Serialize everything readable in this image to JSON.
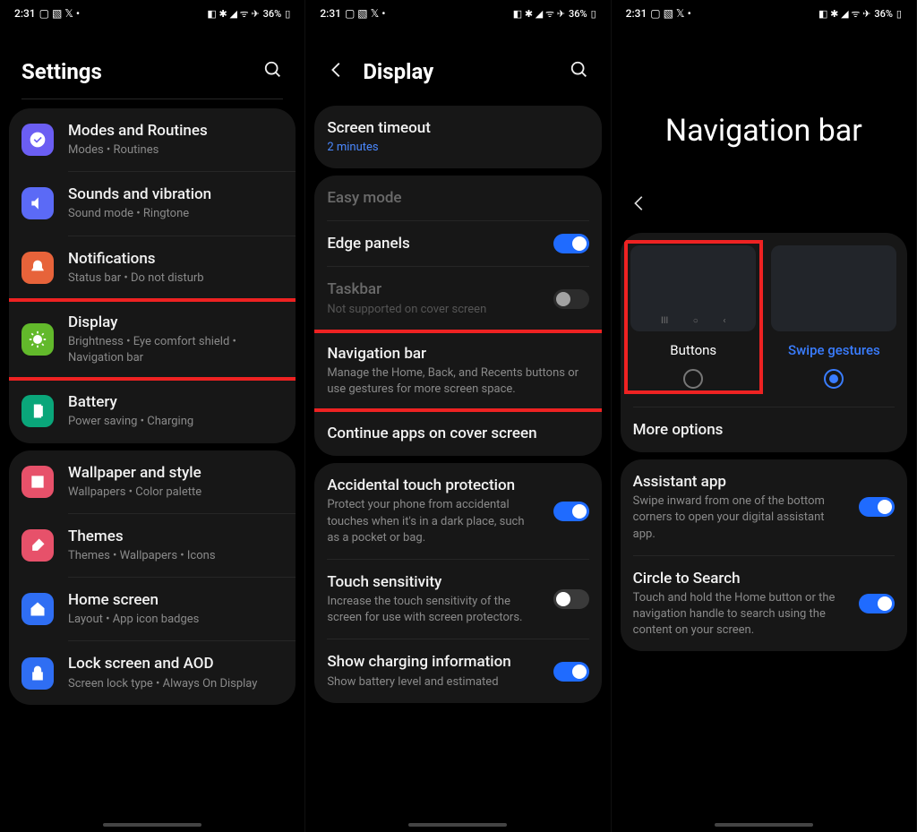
{
  "status": {
    "time": "2:31",
    "battery": "36%"
  },
  "s1": {
    "title": "Settings",
    "groups": [
      {
        "items": [
          {
            "key": "modes",
            "title": "Modes and Routines",
            "sub": "Modes  •  Routines",
            "color": "#6b5ef3",
            "icon": "check-circle"
          },
          {
            "key": "sounds",
            "title": "Sounds and vibration",
            "sub": "Sound mode  •  Ringtone",
            "color": "#5b6af6",
            "icon": "volume"
          },
          {
            "key": "notifications",
            "title": "Notifications",
            "sub": "Status bar  •  Do not disturb",
            "color": "#e7633a",
            "icon": "bell"
          },
          {
            "key": "display",
            "title": "Display",
            "sub": "Brightness  •  Eye comfort shield  •  Navigation bar",
            "color": "#62b92b",
            "icon": "sun",
            "highlight": true
          },
          {
            "key": "battery",
            "title": "Battery",
            "sub": "Power saving  •  Charging",
            "color": "#0aa67a",
            "icon": "battery"
          }
        ]
      },
      {
        "items": [
          {
            "key": "wallpaper",
            "title": "Wallpaper and style",
            "sub": "Wallpapers  •  Color palette",
            "color": "#e7516a",
            "icon": "image"
          },
          {
            "key": "themes",
            "title": "Themes",
            "sub": "Themes  •  Wallpapers  •  Icons",
            "color": "#e7516a",
            "icon": "brush"
          },
          {
            "key": "home",
            "title": "Home screen",
            "sub": "Layout  •  App icon badges",
            "color": "#2f6ef3",
            "icon": "home"
          },
          {
            "key": "lock",
            "title": "Lock screen and AOD",
            "sub": "Screen lock type  •  Always On Display",
            "color": "#2f6ef3",
            "icon": "lock"
          }
        ]
      }
    ]
  },
  "s2": {
    "title": "Display",
    "groups": [
      {
        "items": [
          {
            "key": "timeout",
            "title": "Screen timeout",
            "sub": "2 minutes",
            "subBlue": true
          }
        ]
      },
      {
        "items": [
          {
            "key": "easymode",
            "title": "Easy mode",
            "dim": true
          },
          {
            "key": "edge",
            "title": "Edge panels",
            "toggle": "on"
          },
          {
            "key": "taskbar",
            "title": "Taskbar",
            "sub": "Not supported on cover screen",
            "dim": true,
            "toggle": "off-dim"
          },
          {
            "key": "navbar",
            "title": "Navigation bar",
            "sub": "Manage the Home, Back, and Recents buttons or use gestures for more screen space.",
            "highlight": true
          },
          {
            "key": "continue",
            "title": "Continue apps on cover screen"
          }
        ],
        "sep": "full"
      },
      {
        "items": [
          {
            "key": "atp",
            "title": "Accidental touch protection",
            "sub": "Protect your phone from accidental touches when it's in a dark place, such as a pocket or bag.",
            "toggle": "on"
          },
          {
            "key": "touchsens",
            "title": "Touch sensitivity",
            "sub": "Increase the touch sensitivity of the screen for use with screen protectors.",
            "toggle": "off"
          },
          {
            "key": "charging",
            "title": "Show charging information",
            "sub": "Show battery level and estimated",
            "toggle": "on"
          }
        ],
        "sep": "full"
      }
    ]
  },
  "s3": {
    "title": "Navigation bar",
    "choices": [
      {
        "key": "buttons",
        "label": "Buttons",
        "selected": false,
        "highlight": true,
        "showButtons": true
      },
      {
        "key": "swipe",
        "label": "Swipe gestures",
        "selected": true,
        "showButtons": false
      }
    ],
    "moreOptions": "More options",
    "items": [
      {
        "key": "assistant",
        "title": "Assistant app",
        "sub": "Swipe inward from one of the bottom corners to open your digital assistant app.",
        "toggle": "on"
      },
      {
        "key": "circle",
        "title": "Circle to Search",
        "sub": "Touch and hold the Home button or the navigation handle to search using the content on your screen.",
        "toggle": "on"
      }
    ]
  }
}
